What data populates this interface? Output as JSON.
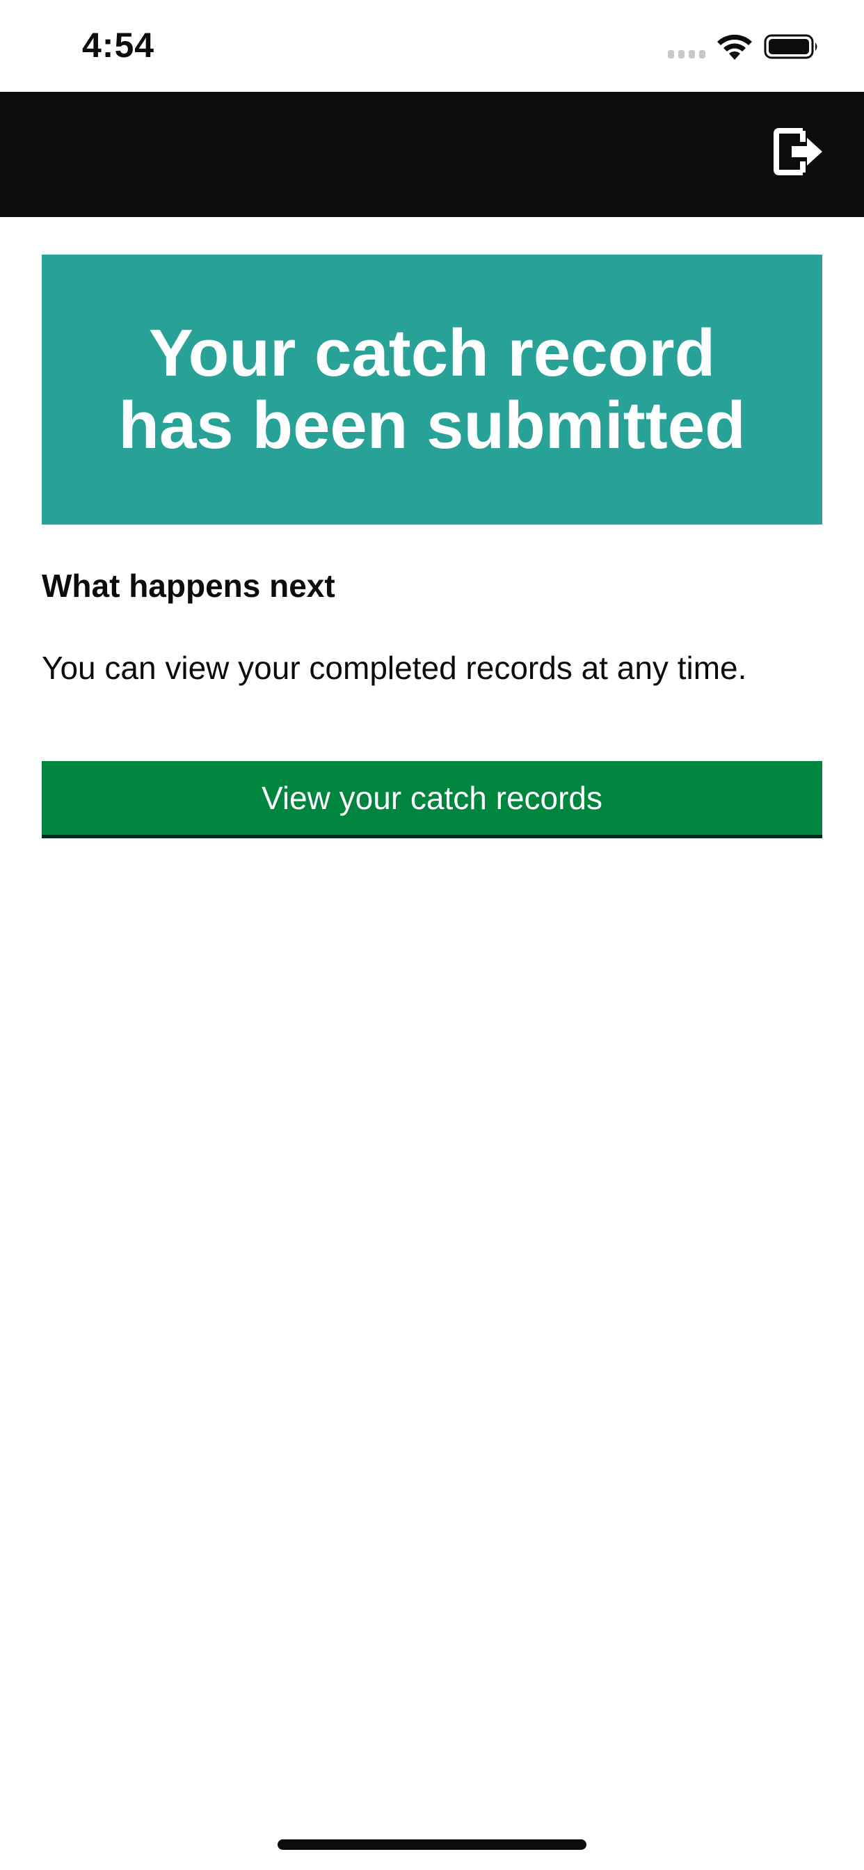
{
  "status_bar": {
    "time": "4:54",
    "icons": [
      "cellular-signal-icon",
      "wifi-icon",
      "battery-icon"
    ]
  },
  "header": {
    "logout_icon": "logout-icon"
  },
  "confirmation_panel": {
    "title": "Your catch record has been submitted",
    "background_color": "#28a197"
  },
  "next_steps": {
    "heading": "What happens next",
    "body": "You can view your completed records at any time."
  },
  "actions": {
    "view_records_label": "View your catch records",
    "button_color": "#00853f"
  }
}
